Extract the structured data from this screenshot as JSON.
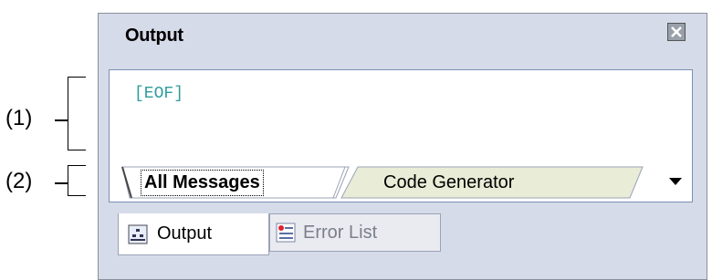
{
  "annotations": {
    "label_1": "(1)",
    "label_2": "(2)"
  },
  "panel": {
    "title": "Output",
    "close_icon": "close-icon",
    "content": "[EOF]",
    "tabs": [
      {
        "label": "All Messages",
        "active": true
      },
      {
        "label": "Code Generator",
        "active": false
      }
    ],
    "dropdown_icon": "chevron-down-icon"
  },
  "bottom_tabs": [
    {
      "label": "Output",
      "icon": "output-icon",
      "active": true
    },
    {
      "label": "Error List",
      "icon": "error-list-icon",
      "active": false
    }
  ]
}
